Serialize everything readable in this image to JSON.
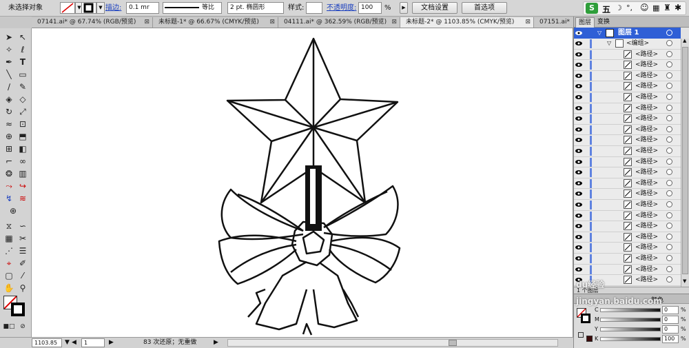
{
  "control_bar": {
    "selection": "未选择对象",
    "stroke_label": "描边:",
    "stroke_weight": "0.1 mr",
    "profile": "等比",
    "brush": "2 pt. 椭圆形",
    "style_label": "样式:",
    "opacity_label": "不透明度:",
    "opacity_value": "100",
    "opacity_unit": "%",
    "doc_setup": "文档设置",
    "prefs": "首选项",
    "ime": "五"
  },
  "tabs": [
    {
      "label": "07141.ai* @ 67.74% (RGB/预览)",
      "close": "⊠"
    },
    {
      "label": "未标题-1* @ 66.67% (CMYK/预览)",
      "close": "⊠"
    },
    {
      "label": "04111.ai* @ 362.59% (RGB/预览)",
      "close": "⊠"
    },
    {
      "label": "未标题-2* @ 1103.85% (CMYK/预览)",
      "close": "⊠"
    },
    {
      "label": "07151.ai*",
      "close": ""
    }
  ],
  "panel": {
    "tab_layers": "图层",
    "tab_transform": "变换",
    "layer_name": "图层 1",
    "group_name": "<编组>",
    "paths": [
      "<路径>",
      "<路径>",
      "<路径>",
      "<路径>",
      "<路径>",
      "<路径>",
      "<路径>",
      "<路径>",
      "<路径>",
      "<路径>",
      "<路径>",
      "<路径>",
      "<路径>",
      "<路径>",
      "<路径>",
      "<路径>",
      "<路径>",
      "<路径>",
      "<路径>",
      "<路径>",
      "<路径>",
      "<路径>"
    ],
    "layer_count": "1 个图层",
    "color_tab": "颜色",
    "cmyk": [
      {
        "label": "C",
        "value": "0",
        "unit": "%"
      },
      {
        "label": "M",
        "value": "0",
        "unit": "%"
      },
      {
        "label": "Y",
        "value": "0",
        "unit": "%"
      },
      {
        "label": "K",
        "value": "100",
        "unit": "%"
      }
    ]
  },
  "status": {
    "zoom": "1103.85",
    "page": "1",
    "undo": "83 次还原；无重做"
  },
  "watermark": "du经验 jingyan.baidu.com"
}
